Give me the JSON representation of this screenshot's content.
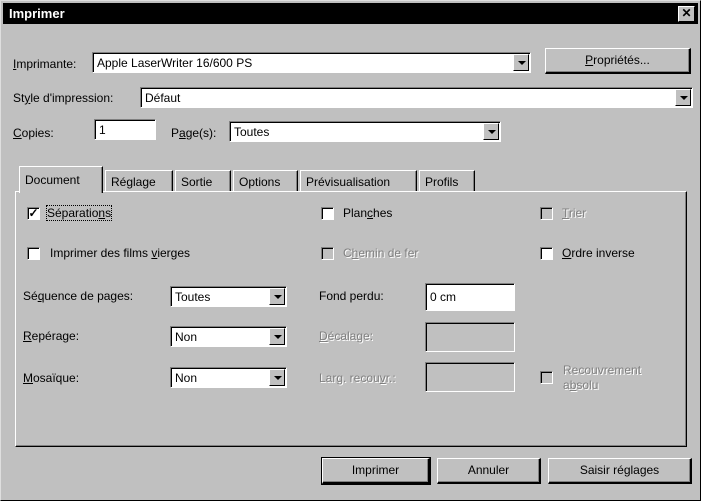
{
  "window": {
    "title": "Imprimer"
  },
  "printer": {
    "label_prefix": "",
    "label_u": "I",
    "label_rest": "mprimante:",
    "value": "Apple LaserWriter 16/600 PS",
    "properties_u": "P",
    "properties_rest": "ropriétés..."
  },
  "style": {
    "label_a": "St",
    "label_u": "y",
    "label_b": "le d'impression:",
    "value": "Défaut"
  },
  "copies": {
    "label_u": "C",
    "label_rest": "opies:",
    "value": "1"
  },
  "pages": {
    "label_a": "P",
    "label_u": "a",
    "label_b": "ge(s):",
    "value": "Toutes"
  },
  "tabs": [
    "Document",
    "Réglage",
    "Sortie",
    "Options",
    "Prévisualisation",
    "Profils"
  ],
  "document": {
    "separations": {
      "label_a": "Séparatio",
      "label_u": "n",
      "label_b": "s",
      "checked": true
    },
    "blank_films": {
      "label_a": "Imprimer des films ",
      "label_u": "v",
      "label_b": "ierges",
      "checked": false
    },
    "plates": {
      "label_a": "Plan",
      "label_u": "c",
      "label_b": "hes",
      "checked": false
    },
    "spreads": {
      "label_a": "C",
      "label_u": "h",
      "label_b": "emin de fer",
      "checked": false,
      "enabled": false
    },
    "collate": {
      "label_u": "T",
      "label_b": "rier",
      "checked": false,
      "enabled": false
    },
    "reverse": {
      "label_u": "O",
      "label_b": "rdre inverse",
      "checked": false
    },
    "page_sequence": {
      "label_a": "Sé",
      "label_u": "q",
      "label_b": "uence de pages:",
      "value": "Toutes"
    },
    "registration": {
      "label_u": "R",
      "label_b": "epérage:",
      "value": "Non"
    },
    "tiling": {
      "label_u": "M",
      "label_b": "osaïque:",
      "value": "Non"
    },
    "bleed": {
      "label": "Fond perdu:",
      "value": "0 cm"
    },
    "offset": {
      "label_u": "D",
      "label_b": "écalage:",
      "value": ""
    },
    "overlap": {
      "label_a": "Larg. recou",
      "label_u": "v",
      "label_b": "r.:",
      "value": ""
    },
    "absolute_overlap": {
      "line1": "Recouvrement",
      "line2_a": "a",
      "line2_u": "b",
      "line2_b": "solu",
      "checked": false,
      "enabled": false
    }
  },
  "buttons": {
    "print": "Imprimer",
    "cancel": "Annuler",
    "capture": "Saisir réglages"
  }
}
